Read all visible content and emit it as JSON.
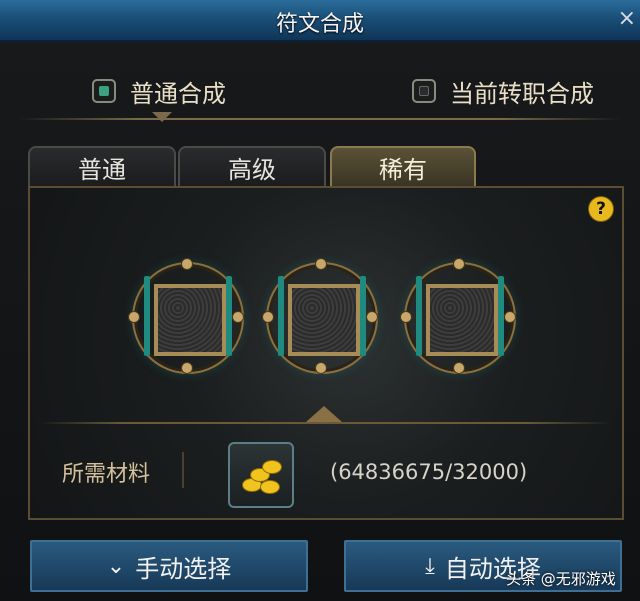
{
  "window": {
    "title": "符文合成",
    "close_glyph": "×"
  },
  "modes": [
    {
      "label": "普通合成",
      "selected": true
    },
    {
      "label": "当前转职合成",
      "selected": false
    }
  ],
  "tabs": [
    {
      "label": "普通",
      "active": false
    },
    {
      "label": "高级",
      "active": false
    },
    {
      "label": "稀有",
      "active": true
    }
  ],
  "help": {
    "glyph": "?"
  },
  "slots": [
    {
      "state": "empty"
    },
    {
      "state": "empty"
    },
    {
      "state": "empty"
    }
  ],
  "material": {
    "label": "所需材料",
    "icon": "gold-coins-icon",
    "count": "(64836675/32000)"
  },
  "buttons": {
    "manual": {
      "label": "手动选择",
      "icon": "chevron-down-icon"
    },
    "auto": {
      "label": "自动选择",
      "icon": "download-tray-icon"
    }
  },
  "watermark": "头条 @无邪游戏",
  "colors": {
    "title_bar": "#1a4f78",
    "accent_gold": "#8c6f3d",
    "teal_glow": "#1f8a80",
    "button_blue": "#2a5a7f"
  }
}
